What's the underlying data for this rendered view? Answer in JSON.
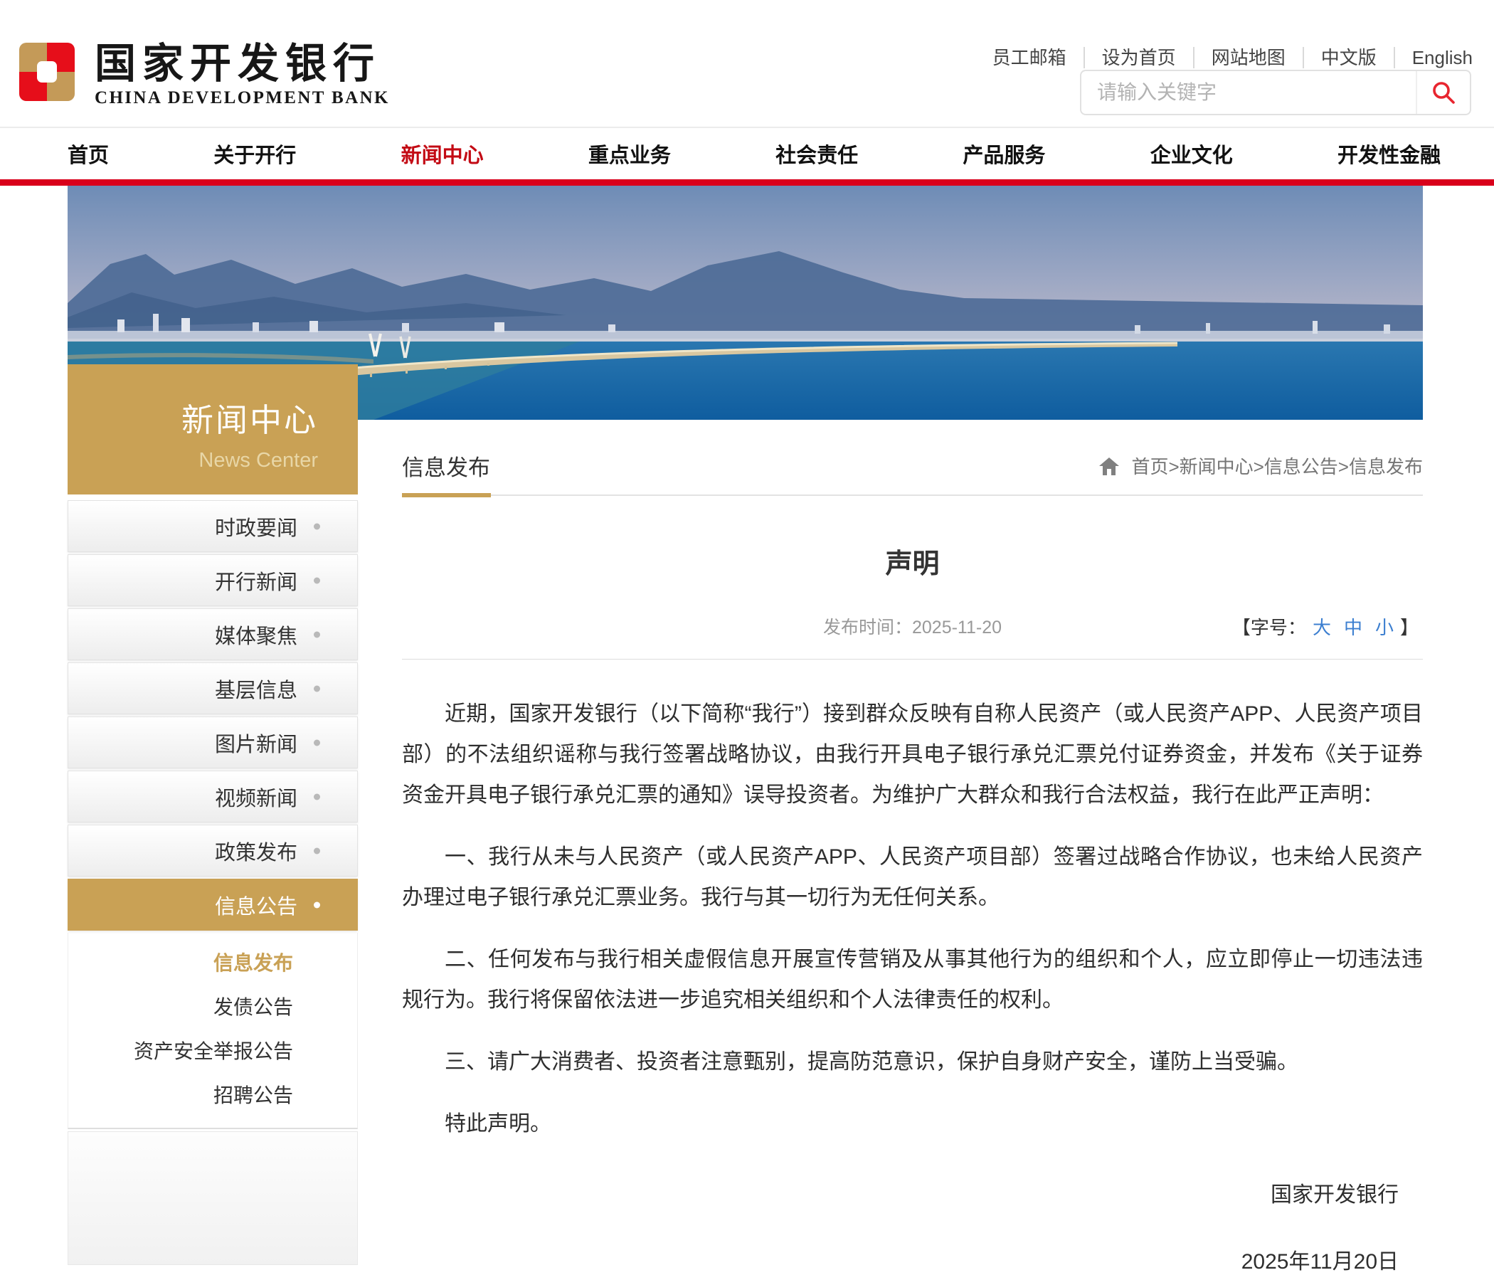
{
  "header": {
    "logo_cn": "国家开发银行",
    "logo_en": "CHINA DEVELOPMENT BANK",
    "top_links": [
      "员工邮箱",
      "设为首页",
      "网站地图",
      "中文版",
      "English"
    ],
    "search": {
      "placeholder": "请输入关键字",
      "icon": "search-icon"
    }
  },
  "nav": {
    "items": [
      {
        "label": "首页",
        "active": false
      },
      {
        "label": "关于开行",
        "active": false
      },
      {
        "label": "新闻中心",
        "active": true
      },
      {
        "label": "重点业务",
        "active": false
      },
      {
        "label": "社会责任",
        "active": false
      },
      {
        "label": "产品服务",
        "active": false
      },
      {
        "label": "企业文化",
        "active": false
      },
      {
        "label": "开发性金融",
        "active": false
      }
    ]
  },
  "sidebar": {
    "title_cn": "新闻中心",
    "title_en": "News Center",
    "items": [
      {
        "label": "时政要闻",
        "active": false
      },
      {
        "label": "开行新闻",
        "active": false
      },
      {
        "label": "媒体聚焦",
        "active": false
      },
      {
        "label": "基层信息",
        "active": false
      },
      {
        "label": "图片新闻",
        "active": false
      },
      {
        "label": "视频新闻",
        "active": false
      },
      {
        "label": "政策发布",
        "active": false
      },
      {
        "label": "信息公告",
        "active": true
      }
    ],
    "subitems": [
      {
        "label": "信息发布",
        "active": true
      },
      {
        "label": "发债公告",
        "active": false
      },
      {
        "label": "资产安全举报公告",
        "active": false
      },
      {
        "label": "招聘公告",
        "active": false
      }
    ]
  },
  "main": {
    "section_title": "信息发布",
    "breadcrumb": "首页>新闻中心>信息公告>信息发布",
    "article": {
      "title": "声明",
      "publish_line": "发布时间：2025-11-20",
      "font_size_open": "【字号：",
      "font_sizes": [
        "大",
        "中",
        "小"
      ],
      "font_size_close": "】",
      "paragraphs": [
        "近期，国家开发银行（以下简称“我行”）接到群众反映有自称人民资产（或人民资产APP、人民资产项目部）的不法组织谣称与我行签署战略协议，由我行开具电子银行承兑汇票兑付证券资金，并发布《关于证券资金开具电子银行承兑汇票的通知》误导投资者。为维护广大群众和我行合法权益，我行在此严正声明：",
        "一、我行从未与人民资产（或人民资产APP、人民资产项目部）签署过战略合作协议，也未给人民资产办理过电子银行承兑汇票业务。我行与其一切行为无任何关系。",
        "二、任何发布与我行相关虚假信息开展宣传营销及从事其他行为的组织和个人，应立即停止一切违法违规行为。我行将保留依法进一步追究相关组织和个人法律责任的权利。",
        "三、请广大消费者、投资者注意甄别，提高防范意识，保护自身财产安全，谨防上当受骗。",
        "特此声明。"
      ],
      "signature": "国家开发银行",
      "date": "2025年11月20日"
    }
  },
  "colors": {
    "accent_red": "#d9001b",
    "nav_active_red": "#c30a14",
    "brand_gold": "#c9a155",
    "link_blue": "#3c7fd0"
  }
}
